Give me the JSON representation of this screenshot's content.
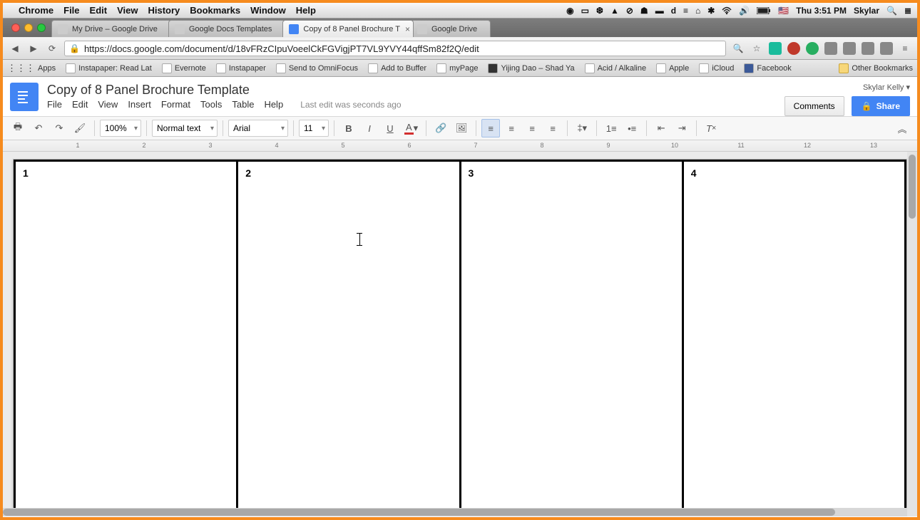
{
  "mac_menu": {
    "app": "Chrome",
    "items": [
      "File",
      "Edit",
      "View",
      "History",
      "Bookmarks",
      "Window",
      "Help"
    ],
    "clock": "Thu 3:51 PM",
    "user": "Skylar"
  },
  "chrome": {
    "tabs": [
      {
        "label": "My Drive – Google Drive"
      },
      {
        "label": "Google Docs Templates"
      },
      {
        "label": "Copy of 8 Panel Brochure T",
        "active": true
      },
      {
        "label": "Google Drive"
      }
    ],
    "url": "https://docs.google.com/document/d/18vFRzCIpuVoeelCkFGVigjPT7VL9YVY44qffSm82f2Q/edit",
    "bookmarks": [
      "Apps",
      "Instapaper: Read Lat",
      "Evernote",
      "Instapaper",
      "Send to OmniFocus",
      "Add to Buffer",
      "myPage",
      "Yijing Dao – Shad Ya",
      "Acid / Alkaline",
      "Apple",
      "iCloud",
      "Facebook"
    ],
    "other_bookmarks": "Other Bookmarks"
  },
  "docs": {
    "title": "Copy of 8 Panel Brochure Template",
    "menus": [
      "File",
      "Edit",
      "View",
      "Insert",
      "Format",
      "Tools",
      "Table",
      "Help"
    ],
    "edit_status": "Last edit was seconds ago",
    "user_label": "Skylar Kelly",
    "comments": "Comments",
    "share": "Share"
  },
  "format": {
    "zoom": "100%",
    "style": "Normal text",
    "font": "Arial",
    "size": "11"
  },
  "ruler": [
    "1",
    "2",
    "3",
    "4",
    "5",
    "6",
    "7",
    "8",
    "9",
    "10",
    "11",
    "12",
    "13"
  ],
  "panels": [
    "1",
    "2",
    "3",
    "4"
  ]
}
